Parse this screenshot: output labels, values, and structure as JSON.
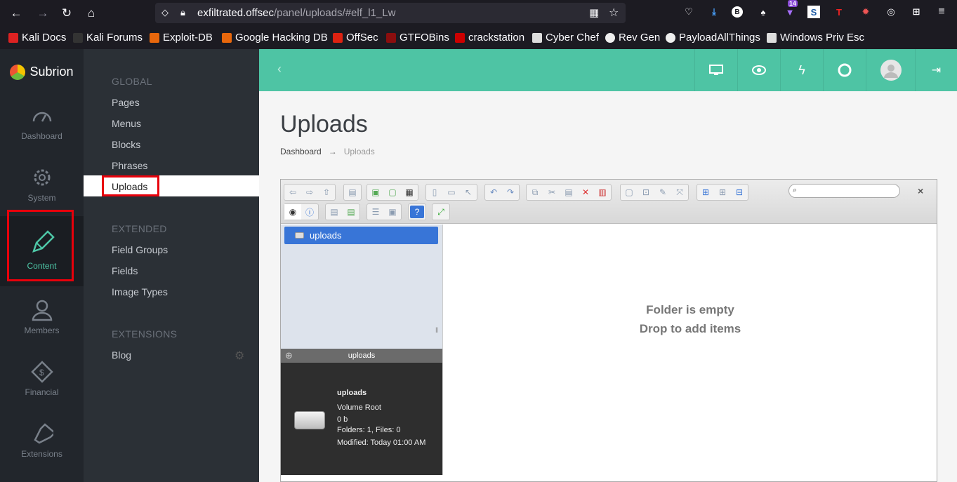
{
  "browser": {
    "url_host": "exfiltrated.offsec",
    "url_path": "/panel/uploads/#elf_l1_Lw",
    "notif_badge": "14",
    "bookmarks": [
      "Kali Docs",
      "Kali Forums",
      "Exploit-DB",
      "Google Hacking DB",
      "OffSec",
      "GTFOBins",
      "crackstation",
      "Cyber Chef",
      "Rev Gen",
      "PayloadAllThings",
      "Windows Priv Esc"
    ]
  },
  "app": {
    "logo": "Subrion",
    "rail": [
      "Dashboard",
      "System",
      "Content",
      "Members",
      "Financial",
      "Extensions"
    ],
    "submenu": {
      "global_head": "GLOBAL",
      "global": [
        "Pages",
        "Menus",
        "Blocks",
        "Phrases",
        "Uploads"
      ],
      "extended_head": "EXTENDED",
      "extended": [
        "Field Groups",
        "Fields",
        "Image Types"
      ],
      "extensions_head": "EXTENSIONS",
      "extensions": [
        "Blog"
      ]
    },
    "title": "Uploads",
    "breadcrumb": {
      "home": "Dashboard",
      "sep": "→",
      "current": "Uploads"
    },
    "filemanager": {
      "tree_root": "uploads",
      "places_title": "uploads",
      "info": {
        "name": "uploads",
        "kind": "Volume Root",
        "size": "0 b",
        "counts": "Folders: 1, Files: 0",
        "modified": "Modified: Today 01:00 AM"
      },
      "empty_line1": "Folder is empty",
      "empty_line2": "Drop to add items",
      "close": "×"
    }
  },
  "colors": {
    "accent": "#4ec4a4",
    "rail_bg": "#22262c",
    "highlight": "#e8000b"
  }
}
